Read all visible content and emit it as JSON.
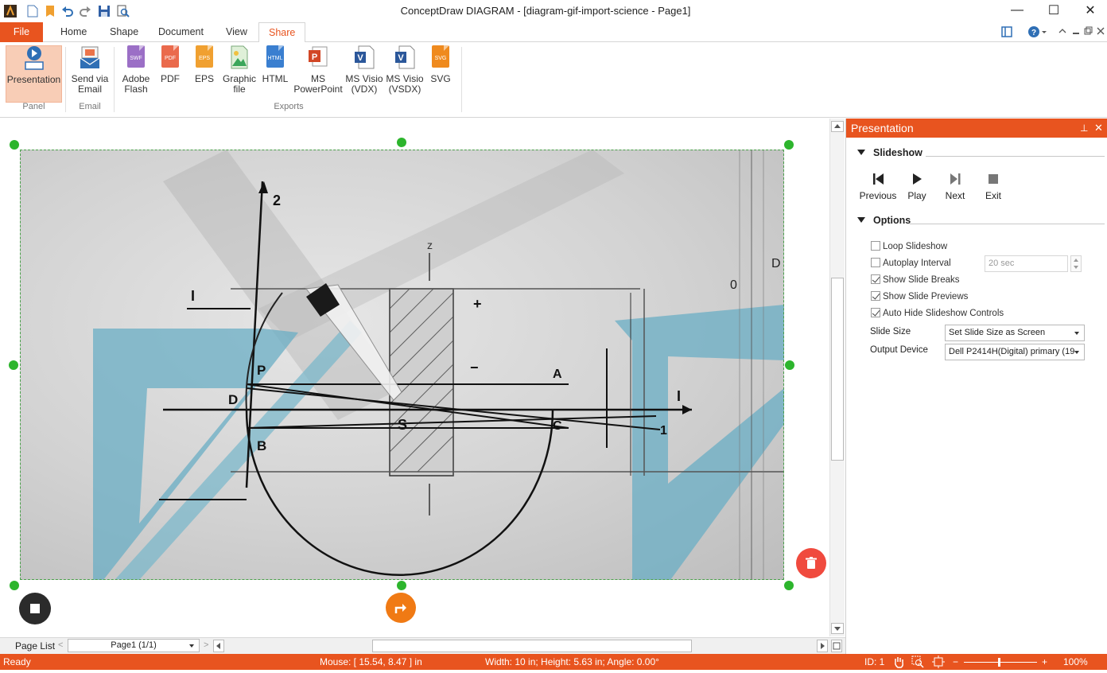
{
  "window": {
    "title": "ConceptDraw DIAGRAM - [diagram-gif-import-science - Page1]",
    "minimize_glyph": "—",
    "maximize_glyph": "☐",
    "close_glyph": "✕"
  },
  "quick_access": [
    "app-logo-icon",
    "new-document-icon",
    "open-folder-icon",
    "undo-icon",
    "redo-icon",
    "save-icon",
    "print-preview-icon"
  ],
  "tabs": {
    "file": "File",
    "home": "Home",
    "shape": "Shape",
    "document": "Document",
    "view": "View",
    "share": "Share"
  },
  "ribbon": {
    "presentation": "Presentation",
    "send_via_email_1": "Send via",
    "send_via_email_2": "Email",
    "adobe_flash_1": "Adobe",
    "adobe_flash_2": "Flash",
    "pdf": "PDF",
    "eps": "EPS",
    "graphic_file_1": "Graphic",
    "graphic_file_2": "file",
    "html": "HTML",
    "ms_powerpoint_1": "MS",
    "ms_powerpoint_2": "PowerPoint",
    "ms_visio_vdx_1": "MS Visio",
    "ms_visio_vdx_2": "(VDX)",
    "ms_visio_vsdx_1": "MS Visio",
    "ms_visio_vsdx_2": "(VSDX)",
    "svg": "SVG",
    "group_panel": "Panel",
    "group_email": "Email",
    "group_exports": "Exports",
    "icon_swf": "SWF",
    "icon_pdf": "PDF",
    "icon_eps": "EPS",
    "icon_html": "HTML",
    "icon_svg": "SVG",
    "icon_p": "P",
    "icon_v": "V"
  },
  "panel": {
    "title": "Presentation",
    "pin_glyph": "⊥",
    "close_glyph": "✕",
    "slideshow_section": "Slideshow",
    "controls": {
      "previous": "Previous",
      "play": "Play",
      "next": "Next",
      "exit": "Exit"
    },
    "options_section": "Options",
    "options": {
      "loop_slideshow": "Loop Slideshow",
      "autoplay_interval": "Autoplay Interval",
      "autoplay_value": "20  sec",
      "show_slide_breaks": "Show Slide Breaks",
      "show_slide_previews": "Show Slide Previews",
      "auto_hide_controls": "Auto Hide Slideshow Controls",
      "loop_checked": false,
      "autoplay_checked": false,
      "breaks_checked": true,
      "previews_checked": true,
      "auto_hide_checked": true
    },
    "slide_size_label": "Slide Size",
    "slide_size_value": "Set Slide Size as Screen",
    "output_device_label": "Output Device",
    "output_device_value": "Dell P2414H(Digital) primary (19"
  },
  "page_bar": {
    "page_list": "Page List",
    "current_page": "Page1 (1/1)"
  },
  "status": {
    "ready": "Ready",
    "mouse": "Mouse: [ 15.54, 8.47 ] in",
    "dimensions": "Width: 10 in;  Height: 5.63 in;  Angle: 0.00°",
    "id": "ID: 1",
    "zoom": "100%"
  },
  "diagram_labels": {
    "z2": "2",
    "z": "z",
    "i2": "I",
    "a_label": "A",
    "c_label": "C",
    "d_label": "D",
    "p_label": "P",
    "b_label": "B",
    "s_label": "S",
    "iy": "I",
    "one": "1",
    "o_label": "0",
    "d_right": "D",
    "plus": "+",
    "minus": "−"
  },
  "colors": {
    "accent": "#e8541f",
    "handle": "#2db52d",
    "ruler_blue": "#6aaec4"
  }
}
